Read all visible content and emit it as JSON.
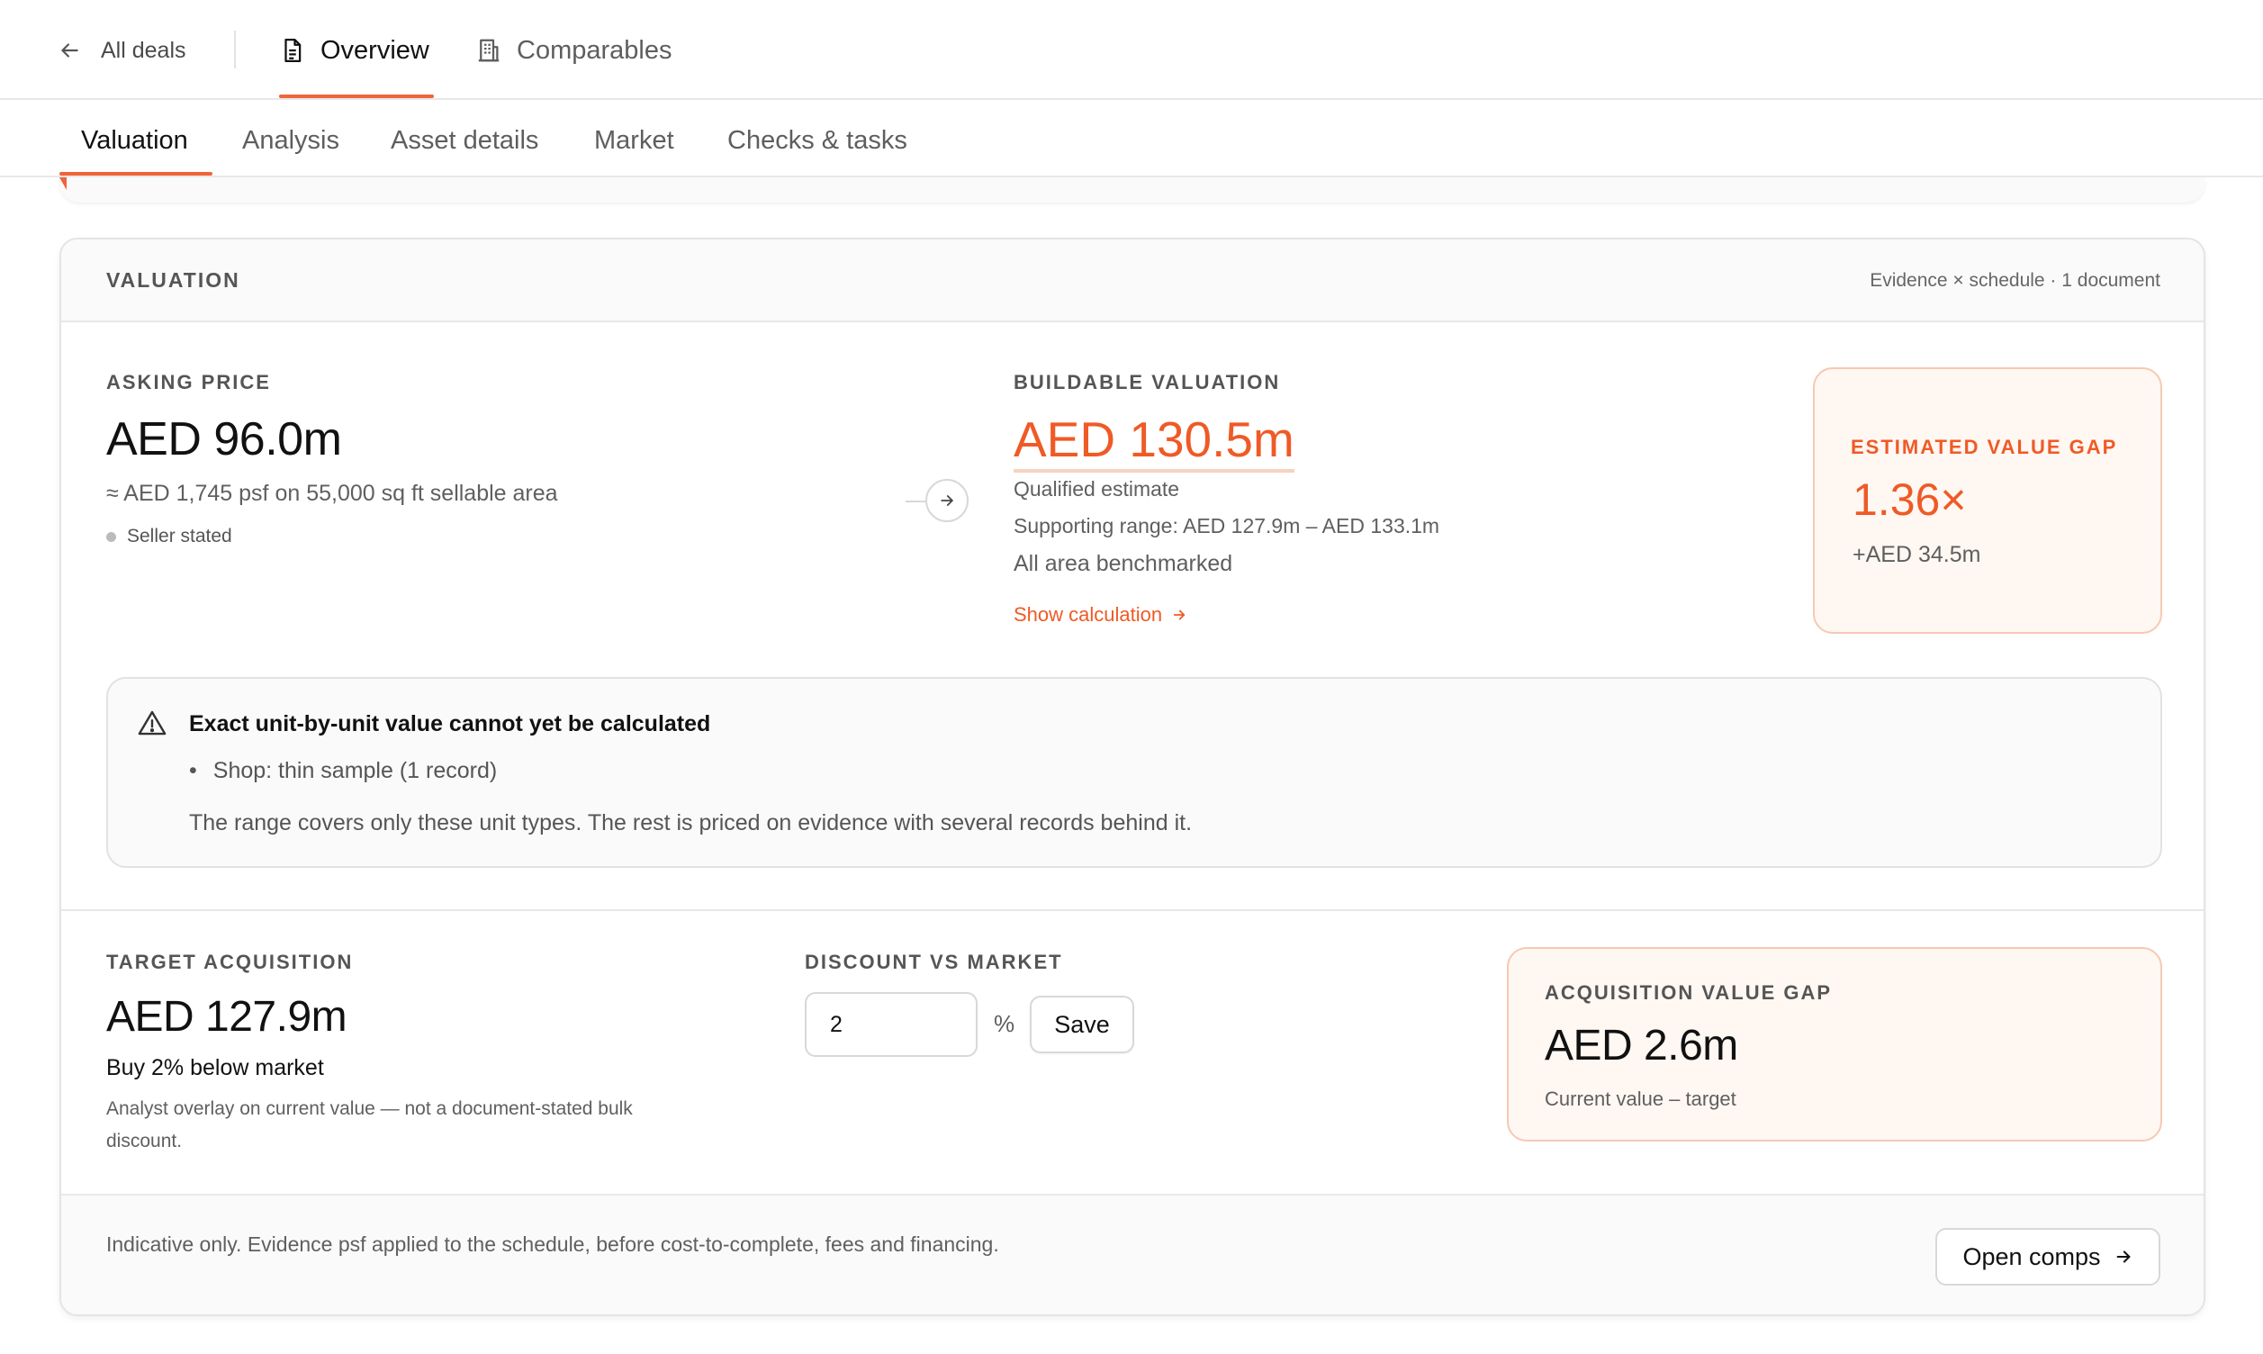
{
  "nav": {
    "back_label": "All deals",
    "tabs": [
      {
        "label": "Overview",
        "active": true
      },
      {
        "label": "Comparables",
        "active": false
      }
    ]
  },
  "subtabs": [
    "Valuation",
    "Analysis",
    "Asset details",
    "Market",
    "Checks & tasks"
  ],
  "valuation": {
    "title": "VALUATION",
    "meta": "Evidence × schedule · 1 document",
    "asking": {
      "label": "ASKING PRICE",
      "value": "AED 96.0m",
      "psf": "≈ AED 1,745 psf on 55,000 sq ft sellable area",
      "source": "Seller stated"
    },
    "buildable": {
      "label": "BUILDABLE VALUATION",
      "value": "AED 130.5m",
      "qualifier": "Qualified estimate",
      "range": "Supporting range: AED 127.9m – AED 133.1m",
      "benchmark": "All area benchmarked",
      "show_calc": "Show calculation"
    },
    "gap": {
      "label": "ESTIMATED VALUE GAP",
      "ratio": "1.36×",
      "diff": "+AED 34.5m"
    },
    "warning": {
      "title": "Exact unit-by-unit value cannot yet be calculated",
      "bullet": "Shop: thin sample (1 record)",
      "note": "The range covers only these unit types. The rest is priced on evidence with several records behind it."
    },
    "target": {
      "label": "TARGET ACQUISITION",
      "value": "AED 127.9m",
      "subtitle": "Buy 2% below market",
      "note_line1": "Analyst overlay on current value — not a document-stated bulk",
      "note_line2": "discount."
    },
    "discount": {
      "label": "DISCOUNT VS MARKET",
      "value": "2",
      "unit": "%",
      "save_label": "Save"
    },
    "acquisition_gap": {
      "label": "ACQUISITION VALUE GAP",
      "value": "AED 2.6m",
      "note": "Current value – target"
    },
    "footer": {
      "note": "Indicative only. Evidence psf applied to the schedule, before cost-to-complete, fees and financing.",
      "button_label": "Open comps"
    }
  },
  "colors": {
    "accent": "#ef5a26",
    "accent_soft_bg": "#fff7f2",
    "accent_border": "#f6c9b3"
  }
}
